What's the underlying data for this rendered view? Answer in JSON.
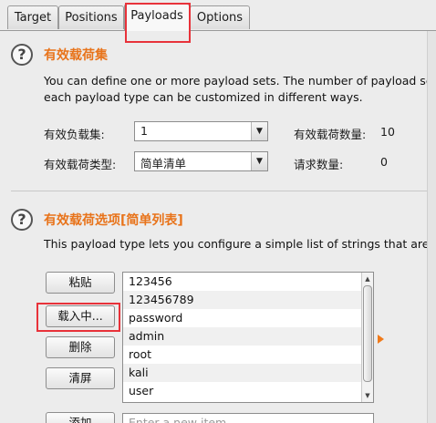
{
  "tabs": [
    {
      "label": "Target"
    },
    {
      "label": "Positions"
    },
    {
      "label": "Payloads"
    },
    {
      "label": "Options"
    }
  ],
  "payload_sets": {
    "title": "有效载荷集",
    "description_line1": "You can define one or more payload sets. The number of payload sets dep",
    "description_line2": "each payload type can be customized in different ways.",
    "set_label": "有效负载集:",
    "set_value": "1",
    "type_label": "有效载荷类型:",
    "type_value": "简单清单",
    "count_label": "有效载荷数量:",
    "count_value": "10",
    "request_label": "请求数量:",
    "request_value": "0"
  },
  "payload_options": {
    "title": "有效载荷选项[简单列表]",
    "description": "This payload type lets you configure a simple list of strings that are used a",
    "buttons": {
      "paste": "粘贴",
      "load": "载入中...",
      "remove": "删除",
      "clear": "清屏",
      "add": "添加"
    },
    "items": [
      "123456",
      "123456789",
      "password",
      "admin",
      "root",
      "kali",
      "user"
    ],
    "add_placeholder": "Enter a new item"
  }
}
